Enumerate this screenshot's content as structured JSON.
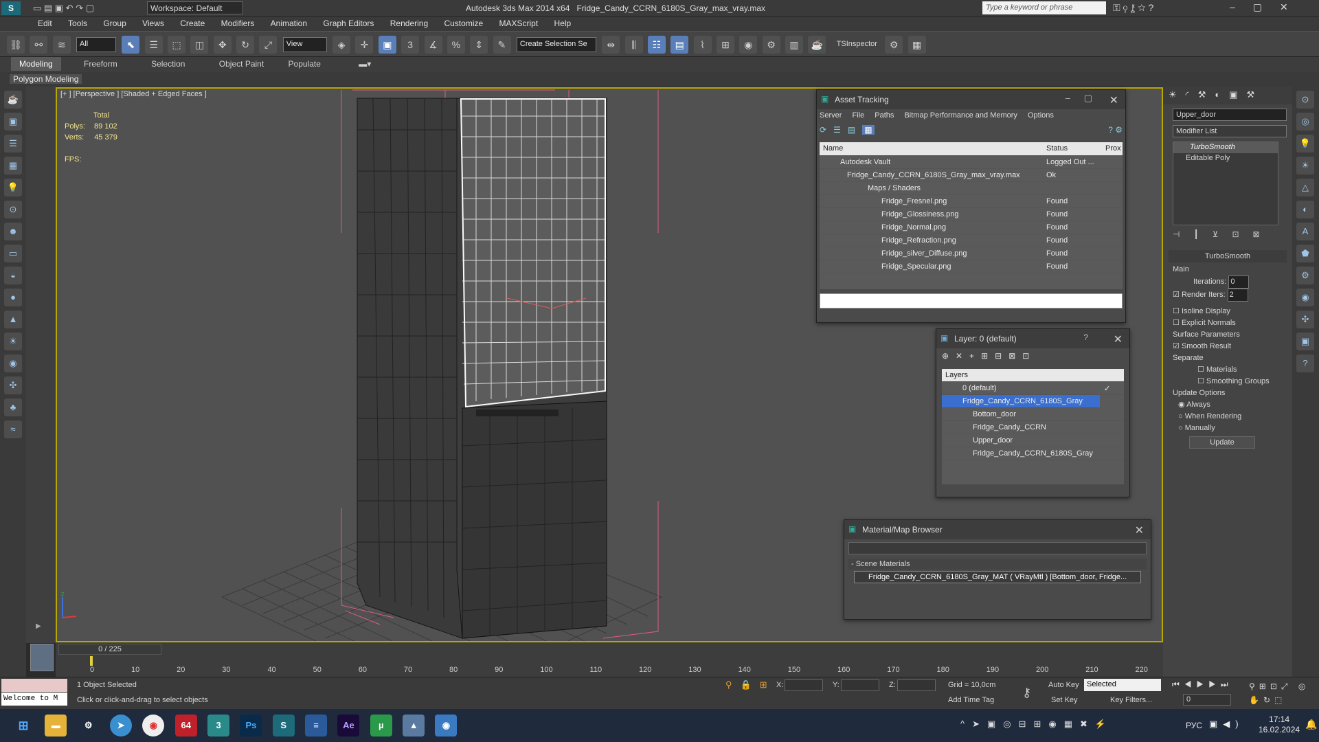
{
  "titlebar": {
    "workspace_label": "Workspace: Default",
    "app_title": "Autodesk 3ds Max  2014 x64",
    "file_title": "Fridge_Candy_CCRN_6180S_Gray_max_vray.max",
    "search_placeholder": "Type a keyword or phrase"
  },
  "menu": [
    "Edit",
    "Tools",
    "Group",
    "Views",
    "Create",
    "Modifiers",
    "Animation",
    "Graph Editors",
    "Rendering",
    "Customize",
    "MAXScript",
    "Help"
  ],
  "toolbar": {
    "selection_filter": "All",
    "ref_coord": "View",
    "named_selection": "Create Selection Se",
    "tsinspector": "TSInspector"
  },
  "ribbon": {
    "tabs": [
      "Modeling",
      "Freeform",
      "Selection",
      "Object Paint",
      "Populate"
    ],
    "active": "Modeling",
    "subtitle": "Polygon Modeling"
  },
  "viewport": {
    "label": "[+ ] [Perspective ] [Shaded + Edged Faces ]",
    "stats_total": "Total",
    "stats_polys_label": "Polys:",
    "stats_polys": "89 102",
    "stats_verts_label": "Verts:",
    "stats_verts": "45 379",
    "fps_label": "FPS:"
  },
  "asset_tracking": {
    "title": "Asset Tracking",
    "menu": [
      "Server",
      "File",
      "Paths",
      "Bitmap Performance and Memory",
      "Options"
    ],
    "columns": [
      "Name",
      "Status",
      "Prox"
    ],
    "rows": [
      {
        "name": "Autodesk Vault",
        "status": "Logged Out ..."
      },
      {
        "name": "Fridge_Candy_CCRN_6180S_Gray_max_vray.max",
        "status": "Ok"
      },
      {
        "name": "Maps / Shaders",
        "status": ""
      },
      {
        "name": "Fridge_Fresnel.png",
        "status": "Found"
      },
      {
        "name": "Fridge_Glossiness.png",
        "status": "Found"
      },
      {
        "name": "Fridge_Normal.png",
        "status": "Found"
      },
      {
        "name": "Fridge_Refraction.png",
        "status": "Found"
      },
      {
        "name": "Fridge_silver_Diffuse.png",
        "status": "Found"
      },
      {
        "name": "Fridge_Specular.png",
        "status": "Found"
      }
    ]
  },
  "layer_window": {
    "title": "Layer: 0 (default)",
    "header": "Layers",
    "items": [
      "0 (default)",
      "Fridge_Candy_CCRN_6180S_Gray",
      "Bottom_door",
      "Fridge_Candy_CCRN",
      "Upper_door",
      "Fridge_Candy_CCRN_6180S_Gray"
    ]
  },
  "material_browser": {
    "title": "Material/Map Browser",
    "section": "- Scene Materials",
    "item": "Fridge_Candy_CCRN_6180S_Gray_MAT ( VRayMtl ) [Bottom_door, Fridge..."
  },
  "command_panel": {
    "object_name": "Upper_door",
    "modifier_list": "Modifier List",
    "stack": [
      "TurboSmooth",
      "Editable Poly"
    ],
    "rollout": "TurboSmooth",
    "main": "Main",
    "iterations_label": "Iterations:",
    "iterations": "0",
    "render_iters_label": "Render Iters:",
    "render_iters": "2",
    "isoline": "Isoline Display",
    "explicit": "Explicit Normals",
    "surface": "Surface Parameters",
    "smooth_result": "Smooth Result",
    "separate": "Separate",
    "materials": "Materials",
    "smoothing_groups": "Smoothing Groups",
    "update_options": "Update Options",
    "always": "Always",
    "when_rendering": "When Rendering",
    "manually": "Manually",
    "update_btn": "Update"
  },
  "timeline": {
    "frame": "0 / 225",
    "ticks": [
      "0",
      "10",
      "20",
      "30",
      "40",
      "50",
      "60",
      "70",
      "80",
      "90",
      "100",
      "110",
      "120",
      "130",
      "140",
      "150",
      "160",
      "170",
      "180",
      "190",
      "200",
      "210",
      "220"
    ]
  },
  "status": {
    "welcome": "Welcome to M",
    "selected": "1 Object Selected",
    "prompt": "Click or click-and-drag to select objects",
    "x_label": "X:",
    "y_label": "Y:",
    "z_label": "Z:",
    "grid": "Grid = 10,0cm",
    "add_time_tag": "Add Time Tag",
    "auto_key": "Auto Key",
    "set_key": "Set Key",
    "key_mode": "Selected",
    "key_filters": "Key Filters...",
    "frame_field": "0"
  },
  "taskbar": {
    "lang": "РУС",
    "time": "17:14",
    "date": "16.02.2024",
    "badge": "64",
    "ps": "Ps",
    "ae": "Ae"
  }
}
